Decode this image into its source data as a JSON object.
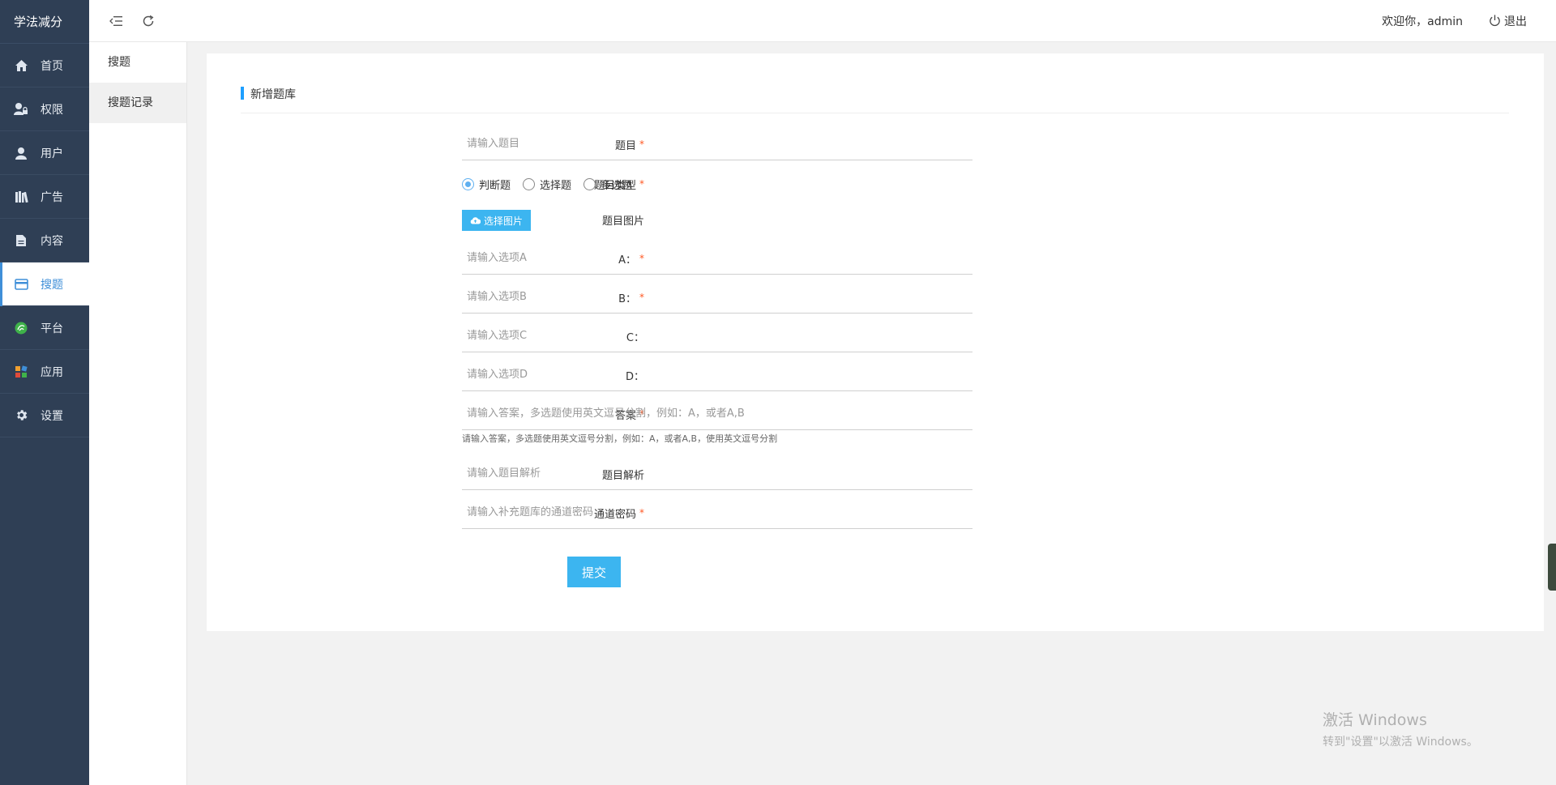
{
  "app": {
    "brand": "学法减分"
  },
  "nav": [
    {
      "label": "首页",
      "icon": "home-icon"
    },
    {
      "label": "权限",
      "icon": "user-lock-icon"
    },
    {
      "label": "用户",
      "icon": "user-icon"
    },
    {
      "label": "广告",
      "icon": "books-icon"
    },
    {
      "label": "内容",
      "icon": "document-icon"
    },
    {
      "label": "搜题",
      "icon": "card-icon",
      "active": true
    },
    {
      "label": "平台",
      "icon": "platform-icon"
    },
    {
      "label": "应用",
      "icon": "apps-icon"
    },
    {
      "label": "设置",
      "icon": "gear-icon"
    }
  ],
  "submenu": [
    {
      "label": "搜题"
    },
    {
      "label": "搜题记录",
      "selected": true
    }
  ],
  "topbar": {
    "welcome": "欢迎你，admin",
    "logout": "退出"
  },
  "form": {
    "title": "新增题库",
    "question": {
      "label": "题目",
      "placeholder": "请输入题目"
    },
    "type": {
      "label": "题目类型",
      "options": [
        "判断题",
        "选择题",
        "多选题"
      ],
      "selected": "判断题"
    },
    "image": {
      "label": "题目图片",
      "button": "选择图片"
    },
    "a": {
      "label": "A：",
      "placeholder": "请输入选项A"
    },
    "b": {
      "label": "B：",
      "placeholder": "请输入选项B"
    },
    "c": {
      "label": "C：",
      "placeholder": "请输入选项C"
    },
    "d": {
      "label": "D：",
      "placeholder": "请输入选项D"
    },
    "answer": {
      "label": "答案",
      "placeholder": "请输入答案，多选题使用英文逗号分割，例如：A，或者A,B",
      "hint": "请输入答案，多选题使用英文逗号分割，例如：A，或者A,B，使用英文逗号分割"
    },
    "analysis": {
      "label": "题目解析",
      "placeholder": "请输入题目解析"
    },
    "password": {
      "label": "通道密码",
      "placeholder": "请输入补充题库的通道密码"
    },
    "submit": "提交",
    "required_mark": "*"
  },
  "watermark": {
    "line1": "激活 Windows",
    "line2": "转到\"设置\"以激活 Windows。"
  },
  "colors": {
    "nav_bg": "#2f3f55",
    "accent": "#3f8fd8",
    "button": "#3cb5f0",
    "required": "#ff5722"
  }
}
